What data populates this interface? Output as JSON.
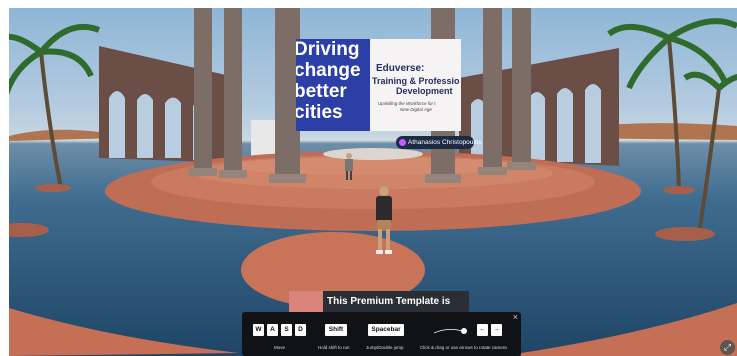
{
  "billboard": {
    "left_lines": [
      "Driving",
      "change",
      "better",
      "cities"
    ],
    "right_title": "Eduverse:",
    "right_sub_lines": [
      "Training & Professio",
      "Development"
    ],
    "right_small_lines": [
      "Upskilling the Workforce for t",
      "New Digital Age"
    ]
  },
  "player_name": "Athanasios Christopoulos",
  "premium_banner": "This Premium Template is",
  "controls": {
    "keys": [
      "W",
      "A",
      "S",
      "D"
    ],
    "shift_label": "Shift",
    "spacebar_label": "Spacebar",
    "arrow_left": "←",
    "arrow_right": "→",
    "move_caption": "Move",
    "run_caption": "Hold shift to run",
    "jump_caption": "Jump/Double jump",
    "camera_caption": "Click & drag or use arrows to rotate camera",
    "close_label": "×"
  },
  "expand_icon": "⤢",
  "colors": {
    "floor": "#c7735a",
    "water": "#2b5878",
    "sky": "#a9c4dc",
    "panel": "#101216",
    "board_blue": "#2c3fa6"
  }
}
